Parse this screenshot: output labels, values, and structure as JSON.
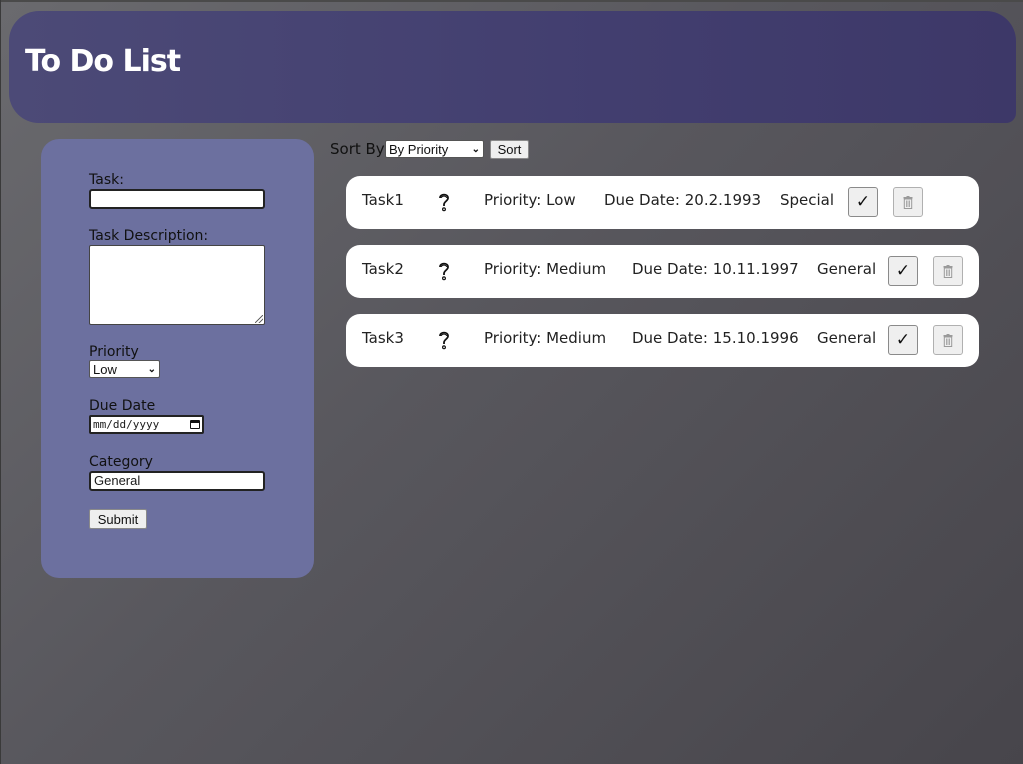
{
  "header": {
    "title": "To Do List"
  },
  "form": {
    "task_label": "Task:",
    "task_value": "",
    "description_label": "Task Description:",
    "description_value": "",
    "priority_label": "Priority",
    "priority_selected": "Low",
    "due_date_label": "Due Date",
    "due_date_placeholder": "mm/dd/yyyy",
    "category_label": "Category",
    "category_value": "General",
    "submit_label": "Submit"
  },
  "sort": {
    "label": "Sort By",
    "selected": "By Priority",
    "button_label": "Sort"
  },
  "tasks": [
    {
      "name": "Task1",
      "priority": "Priority: Low",
      "due_date": "Due Date: 20.2.1993",
      "category": "Special"
    },
    {
      "name": "Task2",
      "priority": "Priority: Medium",
      "due_date": "Due Date: 10.11.1997",
      "category": "General"
    },
    {
      "name": "Task3",
      "priority": "Priority: Medium",
      "due_date": "Due Date: 15.10.1996",
      "category": "General"
    }
  ],
  "icons": {
    "help": "help-icon",
    "complete": "checkmark-icon",
    "delete": "trash-icon",
    "dropdown": "chevron-down-icon",
    "calendar": "calendar-icon"
  },
  "colors": {
    "header": "#423e6f",
    "form_panel": "#6c709f",
    "card": "#ffffff",
    "background": "#58575d"
  }
}
